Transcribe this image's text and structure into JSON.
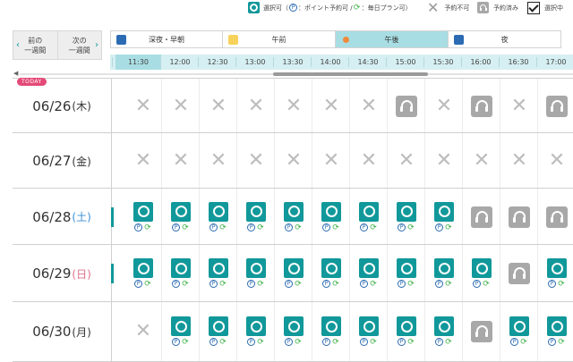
{
  "legend": {
    "available": "選択可（",
    "point": "P",
    "point_text": "：ポイント予約可 / ",
    "renew_text": "：毎日プラン可）",
    "unavailable": "予約不可",
    "booked": "予約済み",
    "selected": "選択中"
  },
  "nav": {
    "prev": "前の\n一週間",
    "next": "次の\n一週間",
    "prev_arrow": "‹",
    "next_arrow": "›"
  },
  "periods": [
    {
      "label": "深夜・早朝",
      "icon": "moon-icon",
      "active": false
    },
    {
      "label": "午前",
      "icon": "sun-icon",
      "active": false
    },
    {
      "label": "午後",
      "icon": "sunset-icon",
      "active": true
    },
    {
      "label": "夜",
      "icon": "moon-icon",
      "active": false
    }
  ],
  "times": [
    "11:30",
    "12:00",
    "12:30",
    "13:00",
    "13:30",
    "14:00",
    "14:30",
    "15:00",
    "15:30",
    "16:00",
    "16:30",
    "17:00"
  ],
  "today_label": "TODAY",
  "rows": [
    {
      "date": "06/26",
      "dow": "(木)",
      "dow_type": "weekday",
      "today": true,
      "partial": "none",
      "cells": [
        "x",
        "x",
        "x",
        "x",
        "x",
        "x",
        "x",
        "b",
        "x",
        "b",
        "x",
        "b"
      ]
    },
    {
      "date": "06/27",
      "dow": "(金)",
      "dow_type": "weekday",
      "today": false,
      "partial": "none",
      "cells": [
        "x",
        "x",
        "x",
        "x",
        "x",
        "x",
        "x",
        "x",
        "x",
        "x",
        "x",
        "x"
      ]
    },
    {
      "date": "06/28",
      "dow": "(土)",
      "dow_type": "sat",
      "today": false,
      "partial": "av",
      "cells": [
        "a",
        "a",
        "a",
        "a",
        "a",
        "a",
        "a",
        "a",
        "a",
        "b",
        "b",
        "b"
      ]
    },
    {
      "date": "06/29",
      "dow": "(日)",
      "dow_type": "sun",
      "today": false,
      "partial": "av",
      "cells": [
        "a",
        "a",
        "a",
        "a",
        "a",
        "a",
        "a",
        "a",
        "a",
        "a",
        "b",
        "a"
      ]
    },
    {
      "date": "06/30",
      "dow": "(月)",
      "dow_type": "weekday",
      "today": false,
      "partial": "none",
      "cells": [
        "x",
        "a",
        "a",
        "a",
        "a",
        "a",
        "a",
        "a",
        "a",
        "b",
        "a",
        "a"
      ]
    }
  ],
  "colors": {
    "available": "#11989a",
    "booked": "#a8a8a8",
    "active_period": "#a8dde3",
    "today_badge": "#e44a77"
  }
}
